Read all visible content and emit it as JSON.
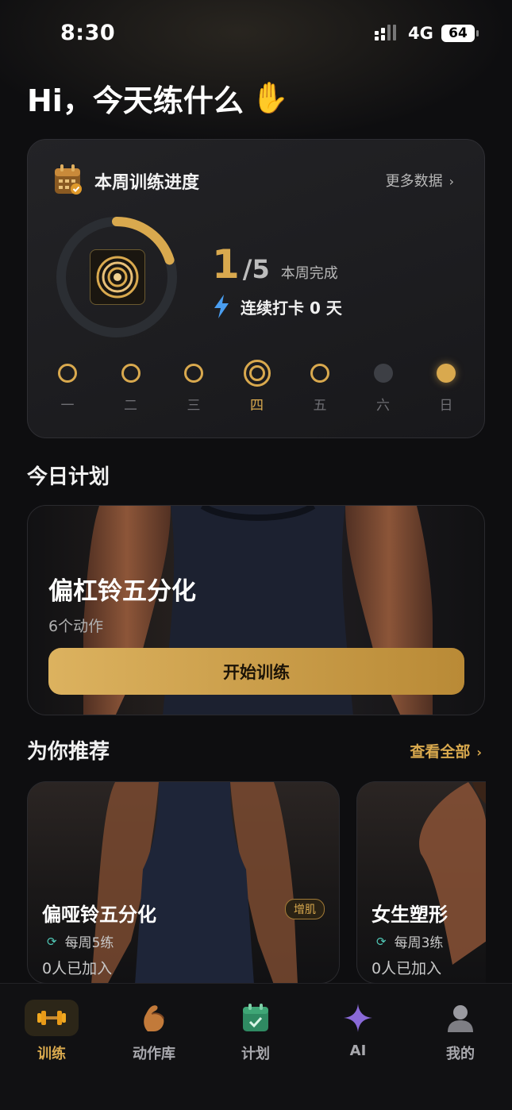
{
  "status": {
    "time": "8:30",
    "network": "4G",
    "battery": "64"
  },
  "greeting": {
    "text": "Hi，今天练什么",
    "emoji": "✋"
  },
  "progress": {
    "title": "本周训练进度",
    "more": "更多数据",
    "done": "1",
    "total": "/5",
    "done_label": "本周完成",
    "streak": "连续打卡 0 天",
    "ring_fraction": 0.2,
    "days": [
      {
        "label": "一",
        "state": "ring"
      },
      {
        "label": "二",
        "state": "ring"
      },
      {
        "label": "三",
        "state": "ring"
      },
      {
        "label": "四",
        "state": "today"
      },
      {
        "label": "五",
        "state": "ring"
      },
      {
        "label": "六",
        "state": "gray"
      },
      {
        "label": "日",
        "state": "filled"
      }
    ]
  },
  "today": {
    "section": "今日计划",
    "plan_name": "偏杠铃五分化",
    "plan_sub": "6个动作",
    "start": "开始训练"
  },
  "recommend": {
    "section": "为你推荐",
    "more": "查看全部",
    "cards": [
      {
        "name": "偏哑铃五分化",
        "badge": "增肌",
        "freq": "每周5练",
        "joined": "0人已加入"
      },
      {
        "name": "女生塑形",
        "freq": "每周3练",
        "joined": "0人已加入"
      }
    ]
  },
  "tabs": [
    {
      "label": "训练",
      "icon": "dumbbell-icon",
      "active": true
    },
    {
      "label": "动作库",
      "icon": "muscle-arm-icon"
    },
    {
      "label": "计划",
      "icon": "calendar-check-icon"
    },
    {
      "label": "AI",
      "icon": "sparkle-icon"
    },
    {
      "label": "我的",
      "icon": "user-icon"
    }
  ],
  "colors": {
    "accent": "#d9a94e",
    "background": "#0e0e10",
    "card": "#1e1e21"
  }
}
